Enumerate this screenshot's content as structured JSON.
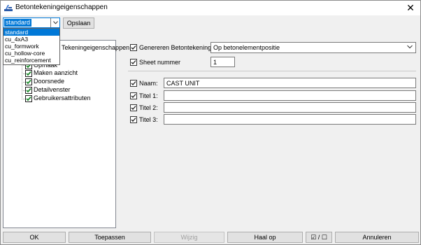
{
  "window": {
    "title": "Betontekeningeigenschappen",
    "close_glyph": "✕",
    "icon": "drawing-app-icon"
  },
  "toolbar": {
    "preset_value": "standard",
    "save_label": "Opslaan"
  },
  "preset_dropdown": {
    "options": [
      "standard",
      "cu_4xA3",
      "cu_formwork",
      "cu_hollow-core",
      "cu_reinforcement"
    ],
    "selected_index": 0
  },
  "tree": {
    "root_label": "Tekeningeigenschappen",
    "items": [
      {
        "label": "Opmaak",
        "checked": true
      },
      {
        "label": "Maken aanzicht",
        "checked": true
      },
      {
        "label": "Doorsnede",
        "checked": true
      },
      {
        "label": "Detailvenster",
        "checked": true
      },
      {
        "label": "Gebruikersattributen",
        "checked": true
      }
    ]
  },
  "form": {
    "generate_label": "Genereren Betontekening",
    "generate_value": "Op betonelementpositie",
    "sheet_label": "Sheet nummer",
    "sheet_value": "1",
    "name_label": "Naam:",
    "name_value": "CAST UNIT",
    "title1_label": "Titel 1:",
    "title1_value": "",
    "title2_label": "Titel 2:",
    "title2_value": "",
    "title3_label": "Titel 3:",
    "title3_value": ""
  },
  "footer": {
    "ok": "OK",
    "apply": "Toepassen",
    "modify": "Wijzig",
    "get": "Haal op",
    "toggle": "☑ / ☐",
    "cancel": "Annuleren"
  },
  "colors": {
    "accent": "#0078d7",
    "check": "#1e8a2e"
  }
}
